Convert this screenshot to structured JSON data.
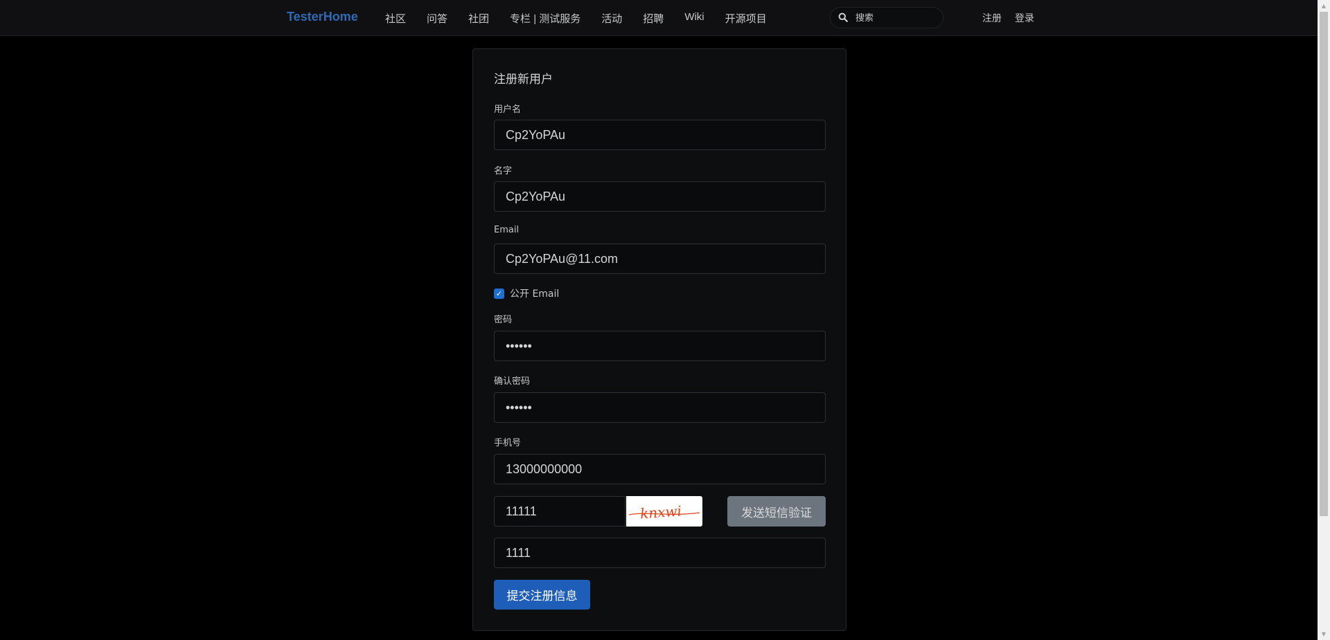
{
  "nav": {
    "brand": "TesterHome",
    "links": [
      "社区",
      "问答",
      "社团",
      "专栏 | 测试服务",
      "活动",
      "招聘",
      "Wiki",
      "开源项目"
    ],
    "search_placeholder": "搜索",
    "right_links": [
      "注册",
      "登录"
    ]
  },
  "form": {
    "title": "注册新用户",
    "username_label": "用户名",
    "username_value": "Cp2YoPAu",
    "name_label": "名字",
    "name_value": "Cp2YoPAu",
    "email_label": "Email",
    "email_value": "Cp2YoPAu@11.com",
    "public_email_label": "公开 Email",
    "public_email_checked": true,
    "password_label": "密码",
    "password_value": "••••••",
    "confirm_password_label": "确认密码",
    "confirm_password_value": "••••••",
    "phone_label": "手机号",
    "phone_value": "13000000000",
    "captcha_value": "11111",
    "captcha_image_text": "knxwi",
    "send_sms_label": "发送短信验证",
    "sms_code_value": "1111",
    "submit_label": "提交注册信息"
  },
  "colors": {
    "brand": "#2e6bb4",
    "primary_button": "#1e5eb8",
    "secondary_button": "#6c757d",
    "captcha_text": "#e0451c"
  }
}
